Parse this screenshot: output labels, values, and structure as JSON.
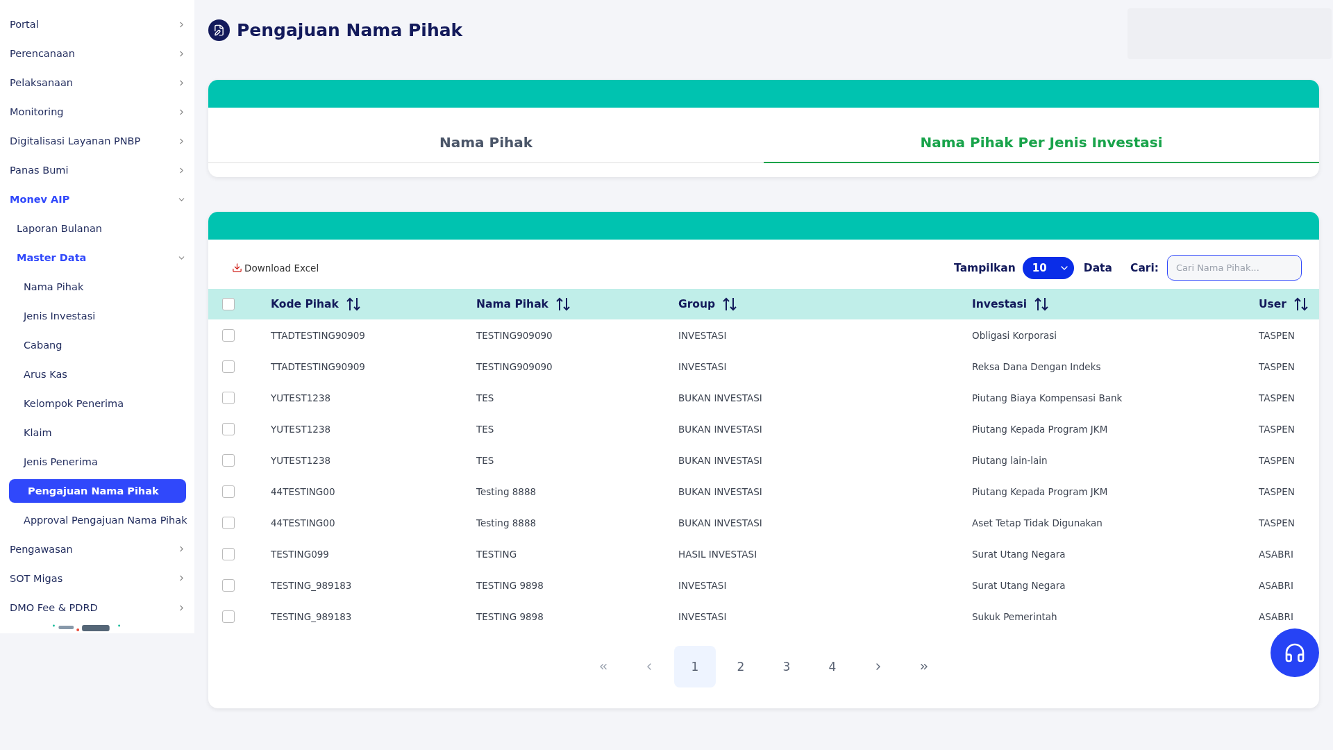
{
  "sidebar": {
    "items": [
      {
        "label": "Portal",
        "expanded": false,
        "selected": false
      },
      {
        "label": "Perencanaan",
        "expanded": false,
        "selected": false
      },
      {
        "label": "Pelaksanaan",
        "expanded": false,
        "selected": false
      },
      {
        "label": "Monitoring",
        "expanded": false,
        "selected": false
      },
      {
        "label": "Digitalisasi Layanan PNBP",
        "expanded": false,
        "selected": false
      },
      {
        "label": "Panas Bumi",
        "expanded": false,
        "selected": false
      },
      {
        "label": "Monev AIP",
        "expanded": true,
        "selected": false,
        "children": [
          {
            "label": "Laporan Bulanan",
            "selected": false
          },
          {
            "label": "Master Data",
            "expanded": true,
            "selected": false,
            "children": [
              {
                "label": "Nama Pihak",
                "selected": false
              },
              {
                "label": "Jenis Investasi",
                "selected": false
              },
              {
                "label": "Cabang",
                "selected": false
              },
              {
                "label": "Arus Kas",
                "selected": false
              },
              {
                "label": "Kelompok Penerima",
                "selected": false
              },
              {
                "label": "Klaim",
                "selected": false
              },
              {
                "label": "Jenis Penerima",
                "selected": false
              },
              {
                "label": "Pengajuan Nama Pihak",
                "selected": true
              },
              {
                "label": "Approval Pengajuan Nama Pihak",
                "selected": false
              }
            ]
          }
        ]
      },
      {
        "label": "Pengawasan",
        "expanded": false,
        "selected": false
      },
      {
        "label": "SOT Migas",
        "expanded": false,
        "selected": false
      },
      {
        "label": "DMO Fee & PDRD",
        "expanded": false,
        "selected": false
      }
    ]
  },
  "page_title": "Pengajuan Nama Pihak",
  "tabs": [
    {
      "label": "Nama Pihak",
      "selected": false
    },
    {
      "label": "Nama Pihak Per Jenis Investasi",
      "selected": true
    }
  ],
  "toolbar": {
    "download": "Download Excel",
    "show_label": "Tampilkan",
    "page_size": "10",
    "show_suffix": "Data",
    "search_label": "Cari:",
    "search": {
      "placeholder": "Cari Nama Pihak..."
    }
  },
  "table": {
    "select_all_checked": false,
    "columns": [
      "Kode Pihak",
      "Nama Pihak",
      "Group",
      "Investasi",
      "User"
    ],
    "rows": [
      {
        "checked": false,
        "cells": [
          "TTADTESTING90909",
          "TESTING909090",
          "INVESTASI",
          "Obligasi Korporasi",
          "TASPEN"
        ]
      },
      {
        "checked": false,
        "cells": [
          "TTADTESTING90909",
          "TESTING909090",
          "INVESTASI",
          "Reksa Dana Dengan Indeks",
          "TASPEN"
        ]
      },
      {
        "checked": false,
        "cells": [
          "YUTEST1238",
          "TES",
          "BUKAN INVESTASI",
          "Piutang Biaya Kompensasi Bank",
          "TASPEN"
        ]
      },
      {
        "checked": false,
        "cells": [
          "YUTEST1238",
          "TES",
          "BUKAN INVESTASI",
          "Piutang Kepada Program JKM",
          "TASPEN"
        ]
      },
      {
        "checked": false,
        "cells": [
          "YUTEST1238",
          "TES",
          "BUKAN INVESTASI",
          "Piutang lain-lain",
          "TASPEN"
        ]
      },
      {
        "checked": false,
        "cells": [
          "44TESTING00",
          "Testing 8888",
          "BUKAN INVESTASI",
          "Piutang Kepada Program JKM",
          "TASPEN"
        ]
      },
      {
        "checked": false,
        "cells": [
          "44TESTING00",
          "Testing 8888",
          "BUKAN INVESTASI",
          "Aset Tetap Tidak Digunakan",
          "TASPEN"
        ]
      },
      {
        "checked": false,
        "cells": [
          "TESTING099",
          "TESTING",
          "HASIL INVESTASI",
          "Surat Utang Negara",
          "ASABRI"
        ]
      },
      {
        "checked": false,
        "cells": [
          "TESTING_989183",
          "TESTING 9898",
          "INVESTASI",
          "Surat Utang Negara",
          "ASABRI"
        ]
      },
      {
        "checked": false,
        "cells": [
          "TESTING_989183",
          "TESTING 9898",
          "INVESTASI",
          "Sukuk Pemerintah",
          "ASABRI"
        ]
      }
    ]
  },
  "pagination": {
    "pages": [
      {
        "label": "1",
        "selected": true
      },
      {
        "label": "2",
        "selected": false
      },
      {
        "label": "3",
        "selected": false
      },
      {
        "label": "4",
        "selected": false
      }
    ]
  }
}
